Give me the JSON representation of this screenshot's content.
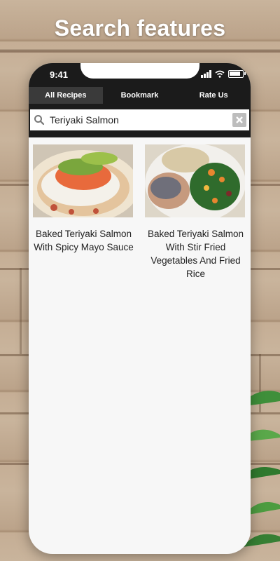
{
  "headline": "Search features",
  "status_bar": {
    "time": "9:41"
  },
  "tabs": [
    {
      "label": "All Recipes",
      "active": true
    },
    {
      "label": "Bookmark",
      "active": false
    },
    {
      "label": "Rate Us",
      "active": false
    }
  ],
  "search": {
    "value": "Teriyaki Salmon",
    "placeholder": ""
  },
  "results": [
    {
      "title": "Baked Teriyaki Salmon With Spicy Mayo Sauce"
    },
    {
      "title": "Baked Teriyaki Salmon With Stir Fried Vegetables And Fried Rice"
    }
  ],
  "colors": {
    "app_bar": "#1b1b1b",
    "active_tab": "#3a3a3a",
    "content_bg": "#f7f7f7",
    "background_wood": "#c1aa90"
  },
  "icons": [
    "search-icon",
    "clear-icon",
    "signal-icon",
    "wifi-icon",
    "battery-icon"
  ]
}
